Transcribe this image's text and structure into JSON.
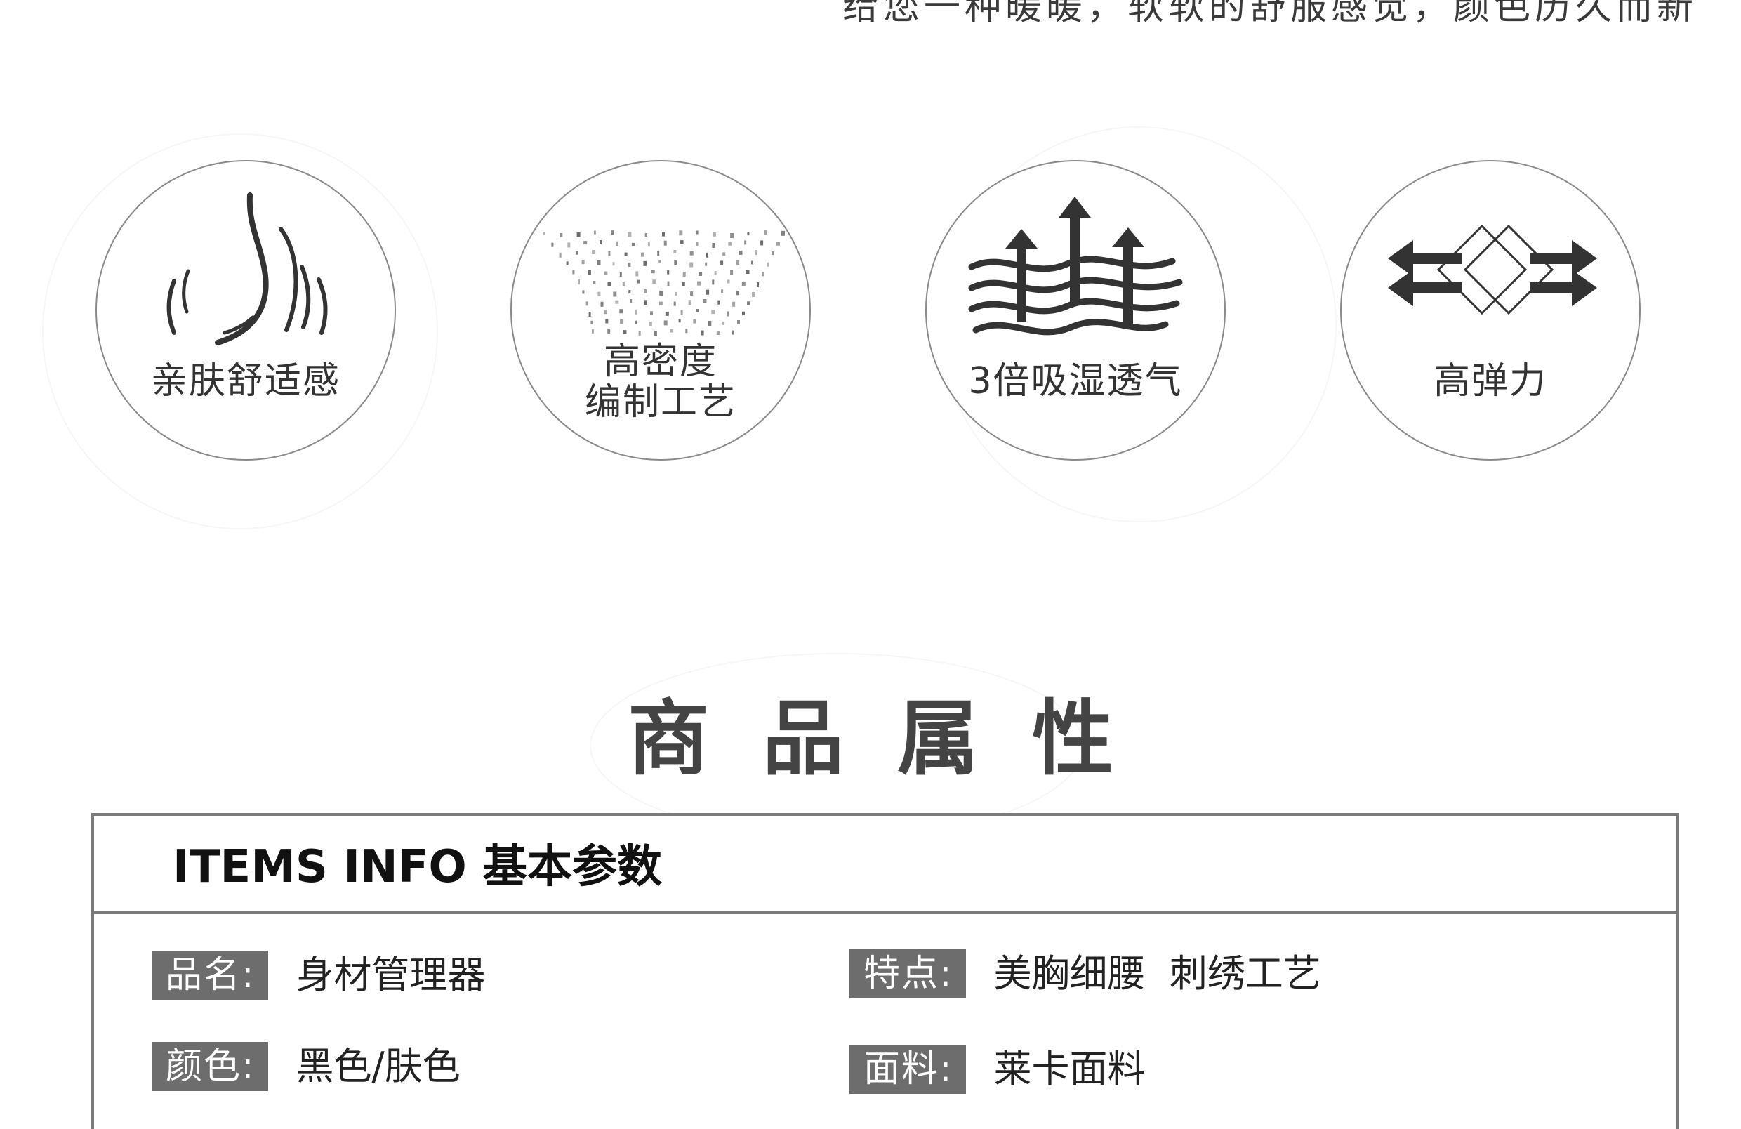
{
  "tagline": "给您一种暖暖，软软的舒服感觉，颜色历久而新",
  "features": [
    {
      "icon": "skin-waves-icon",
      "lines": [
        "亲肤舒适感"
      ]
    },
    {
      "icon": "dense-weave-icon",
      "lines": [
        "高密度",
        "编制工艺"
      ]
    },
    {
      "icon": "moisture-arrows-icon",
      "lines": [
        "3倍吸湿透气"
      ]
    },
    {
      "icon": "elastic-stretch-icon",
      "lines": [
        "高弹力"
      ]
    }
  ],
  "section_title": "商品属性",
  "info": {
    "header": "ITEMS INFO 基本参数",
    "attributes": [
      {
        "key": "品名:",
        "value": "身材管理器"
      },
      {
        "key": "特点:",
        "value": "美胸细腰  刺绣工艺"
      },
      {
        "key": "颜色:",
        "value": "黑色/肤色"
      },
      {
        "key": "面料:",
        "value": "莱卡面料"
      }
    ]
  },
  "colors": {
    "text": "#333333",
    "key_bg": "#6d6d6d",
    "border": "#7a7a7a"
  }
}
